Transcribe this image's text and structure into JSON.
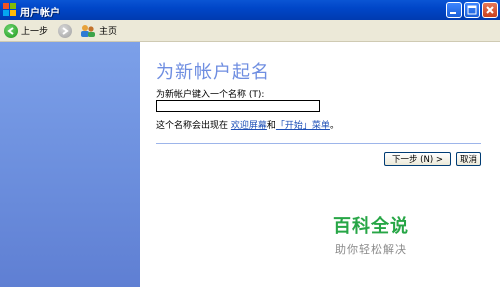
{
  "window": {
    "title": "用户帐户",
    "controls": {
      "minimize_icon": "minimize-icon",
      "maximize_icon": "maximize-icon",
      "close_icon": "close-icon"
    }
  },
  "toolbar": {
    "back_label": "上一步",
    "home_label": "主页"
  },
  "content": {
    "heading": "为新帐户起名",
    "prompt": "为新帐户键入一个名称 (T):",
    "name_value": "",
    "notice_prefix": "这个名称会出现在",
    "notice_link1": "欢迎屏幕",
    "notice_mid": "和",
    "notice_link2": "「开始」菜单",
    "notice_suffix": "。"
  },
  "buttons": {
    "next_label": "下一步 (N) >",
    "cancel_label": "取消"
  },
  "watermark": {
    "main": "百科全说",
    "sub": "助你轻松解决"
  },
  "colors": {
    "titlebar": "#0046c8",
    "left_pane": "#6d90de",
    "heading": "#6f8ee1",
    "link": "#1c4fb7",
    "watermark": "#27a646"
  }
}
